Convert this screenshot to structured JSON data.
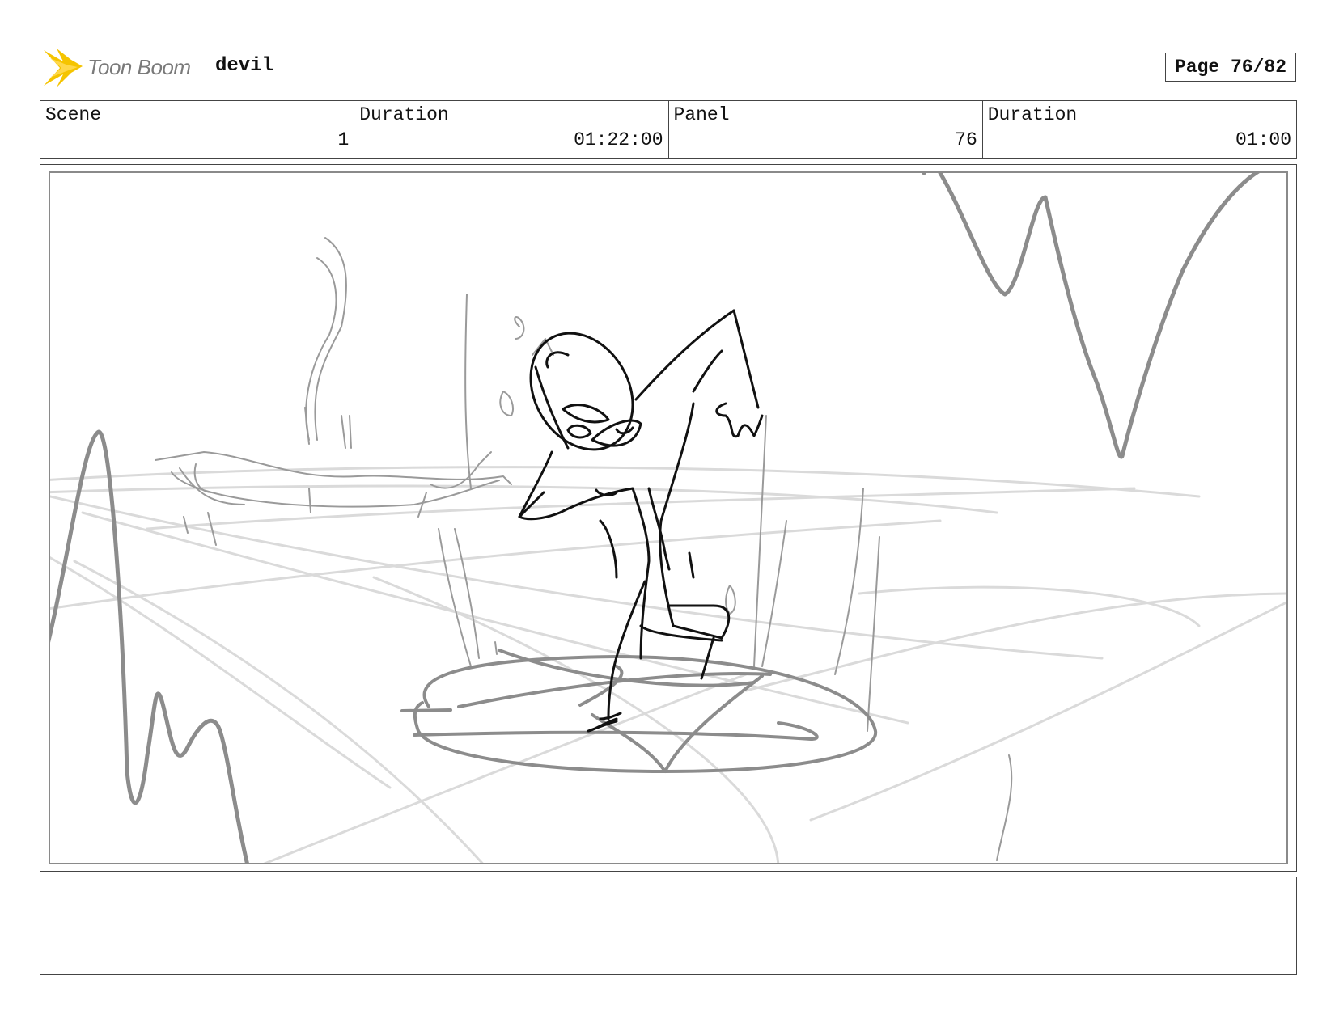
{
  "header": {
    "brand": "Toon Boom",
    "project_title": "devil",
    "page_label": "Page 76/82",
    "logo_icon": "starburst-icon"
  },
  "info": [
    {
      "label": "Scene",
      "value": "1"
    },
    {
      "label": "Duration",
      "value": "01:22:00"
    },
    {
      "label": "Panel",
      "value": "76"
    },
    {
      "label": "Duration",
      "value": "01:00"
    }
  ],
  "panel": {
    "image": "storyboard-sketch",
    "colors": {
      "ink": "#111111",
      "pencil": "#8c8c8c",
      "light": "#d6d6d6",
      "accent": "#f5c400"
    }
  },
  "notes": {
    "text": ""
  }
}
